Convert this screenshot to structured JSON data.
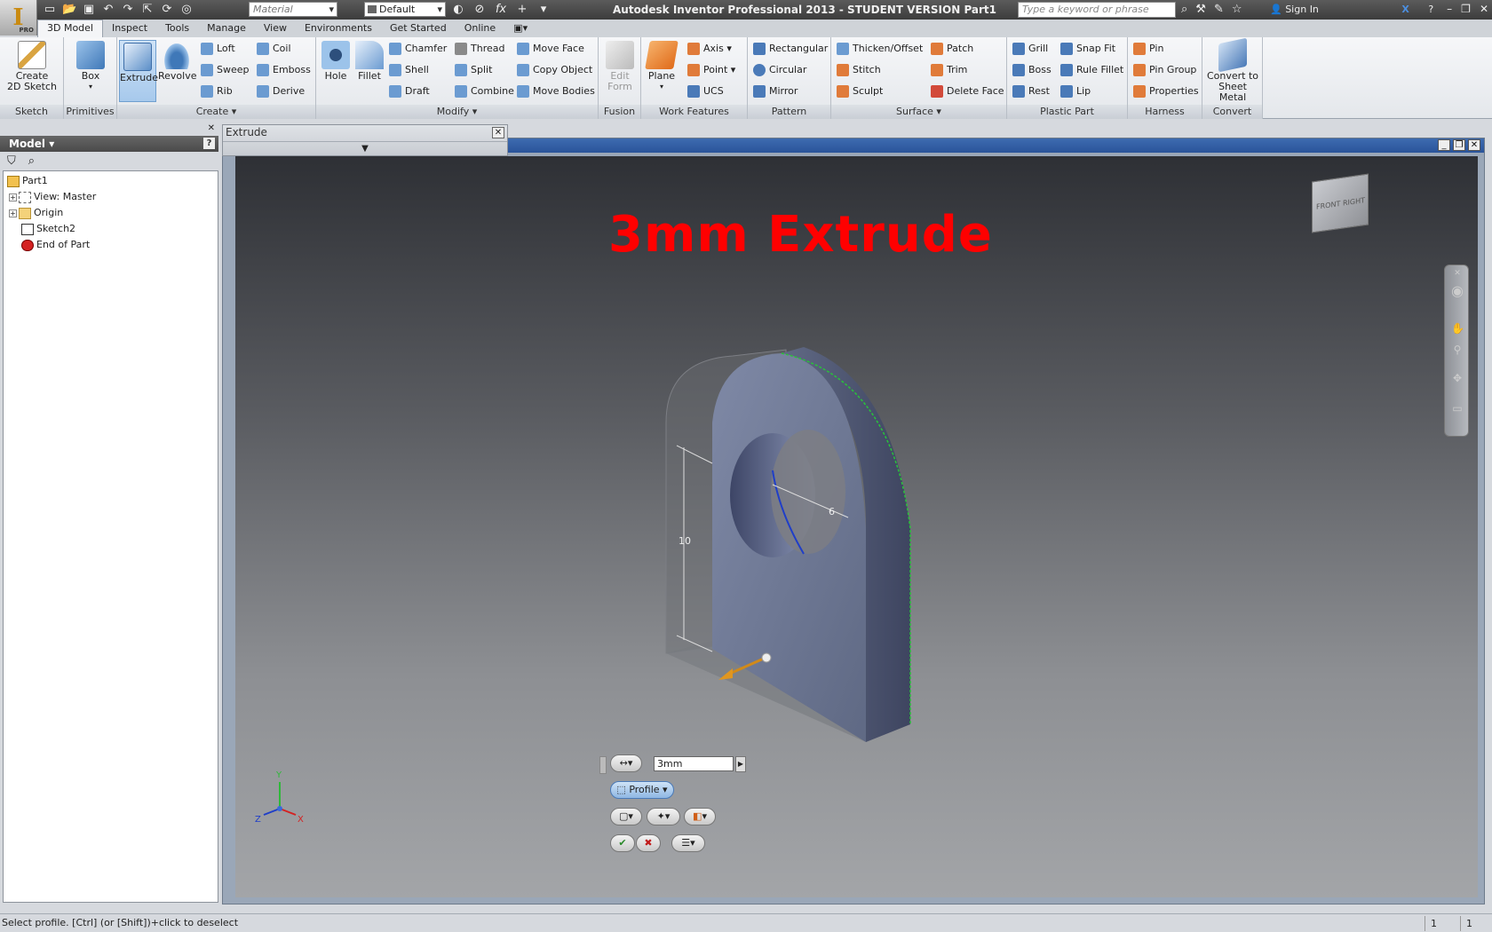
{
  "titlebar": {
    "material_placeholder": "Material",
    "appearance_value": "Default",
    "title": "Autodesk Inventor Professional 2013 - STUDENT VERSION   Part1",
    "search_placeholder": "Type a keyword or phrase",
    "sign_in": "Sign In",
    "app_badge": "PRO"
  },
  "tabs": [
    "3D Model",
    "Inspect",
    "Tools",
    "Manage",
    "View",
    "Environments",
    "Get Started",
    "Online"
  ],
  "ribbon": {
    "sketch": {
      "label": "Sketch",
      "create_line1": "Create",
      "create_line2": "2D Sketch"
    },
    "primitives": {
      "label": "Primitives",
      "box": "Box"
    },
    "create": {
      "label": "Create",
      "extrude": "Extrude",
      "revolve": "Revolve",
      "loft": "Loft",
      "sweep": "Sweep",
      "rib": "Rib",
      "coil": "Coil",
      "emboss": "Emboss",
      "derive": "Derive"
    },
    "modify": {
      "label": "Modify",
      "hole": "Hole",
      "fillet": "Fillet",
      "chamfer": "Chamfer",
      "shell": "Shell",
      "draft": "Draft",
      "thread": "Thread",
      "split": "Split",
      "combine": "Combine",
      "move_face": "Move Face",
      "copy_object": "Copy Object",
      "move_bodies": "Move Bodies"
    },
    "fusion": {
      "label": "Fusion",
      "edit_form_line1": "Edit",
      "edit_form_line2": "Form"
    },
    "work_features": {
      "label": "Work Features",
      "plane": "Plane",
      "axis": "Axis",
      "point": "Point",
      "ucs": "UCS"
    },
    "pattern": {
      "label": "Pattern",
      "rectangular": "Rectangular",
      "circular": "Circular",
      "mirror": "Mirror"
    },
    "surface": {
      "label": "Surface",
      "thicken": "Thicken/Offset",
      "stitch": "Stitch",
      "sculpt": "Sculpt",
      "patch": "Patch",
      "trim": "Trim",
      "delete_face": "Delete Face"
    },
    "plastic_part": {
      "label": "Plastic Part",
      "grill": "Grill",
      "boss": "Boss",
      "rest": "Rest",
      "snap_fit": "Snap Fit",
      "rule_fillet": "Rule Fillet",
      "lip": "Lip"
    },
    "harness": {
      "label": "Harness",
      "pin": "Pin",
      "pin_group": "Pin Group",
      "properties": "Properties"
    },
    "convert": {
      "label": "Convert",
      "line1": "Convert to",
      "line2": "Sheet Metal"
    }
  },
  "browser": {
    "header": "Model",
    "tree": [
      {
        "label": "Part1",
        "icon": "part-icon"
      },
      {
        "label": "View: Master",
        "icon": "view-icon"
      },
      {
        "label": "Origin",
        "icon": "folder-icon"
      },
      {
        "label": "Sketch2",
        "icon": "sketch-icon"
      },
      {
        "label": "End of Part",
        "icon": "end-of-part-icon"
      }
    ]
  },
  "extrude_dialog": {
    "title": "Extrude"
  },
  "viewport": {
    "overlay_title": "3mm Extrude",
    "dimension_height": "10",
    "dimension_diameter": "6",
    "viewcube_front": "FRONT",
    "viewcube_right": "RIGHT",
    "axis_x": "X",
    "axis_y": "Y",
    "axis_z": "Z"
  },
  "minitoolbar": {
    "distance_value": "3mm",
    "profile_label": "Profile"
  },
  "statusbar": {
    "message": "Select profile. [Ctrl] (or [Shift])+click to deselect",
    "count1": "1",
    "count2": "1"
  },
  "colors": {
    "overlay_title": "#ff0000",
    "part_face": "#6e7894",
    "selection_accent": "#a7c9ec",
    "ok_check": "#2a8a2a",
    "cancel_x": "#c01a1a"
  }
}
